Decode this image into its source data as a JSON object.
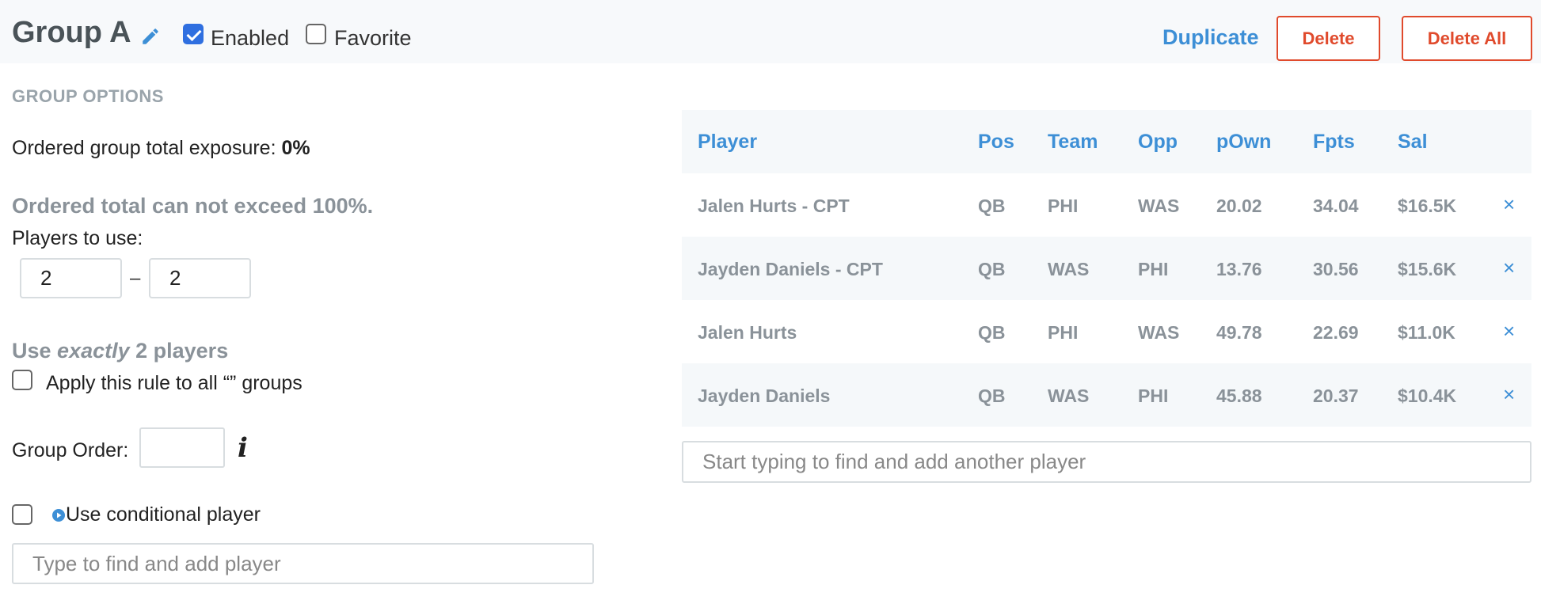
{
  "header": {
    "title": "Group A",
    "edit_icon": "pencil-icon",
    "enabled_label": "Enabled",
    "enabled_checked": true,
    "favorite_label": "Favorite",
    "favorite_checked": false,
    "duplicate_label": "Duplicate",
    "delete_label": "Delete",
    "delete_all_label": "Delete All"
  },
  "options": {
    "section_title": "GROUP OPTIONS",
    "exposure_prefix": "Ordered group total exposure: ",
    "exposure_value": "0%",
    "limit_note": "Ordered total can not exceed 100%.",
    "players_to_use_label": "Players to use:",
    "min_players": "2",
    "range_separator": "–",
    "max_players": "2",
    "summary_prefix": "Use ",
    "summary_emphasis": "exactly",
    "summary_suffix": " 2 players",
    "apply_all_label": "Apply this rule to all “” groups",
    "apply_all_checked": false,
    "group_order_label": "Group Order:",
    "group_order_value": "",
    "info_icon": "info-icon",
    "conditional_label": "Use conditional player",
    "conditional_checked": false,
    "conditional_icon": "play-circle-icon",
    "conditional_search_placeholder": "Type to find and add player"
  },
  "players_table": {
    "columns": [
      "Player",
      "Pos",
      "Team",
      "Opp",
      "pOwn",
      "Fpts",
      "Sal"
    ],
    "rows": [
      {
        "player": "Jalen Hurts - CPT",
        "pos": "QB",
        "team": "PHI",
        "opp": "WAS",
        "pown": "20.02",
        "fpts": "34.04",
        "sal": "$16.5K"
      },
      {
        "player": "Jayden Daniels - CPT",
        "pos": "QB",
        "team": "WAS",
        "opp": "PHI",
        "pown": "13.76",
        "fpts": "30.56",
        "sal": "$15.6K"
      },
      {
        "player": "Jalen Hurts",
        "pos": "QB",
        "team": "PHI",
        "opp": "WAS",
        "pown": "49.78",
        "fpts": "22.69",
        "sal": "$11.0K"
      },
      {
        "player": "Jayden Daniels",
        "pos": "QB",
        "team": "WAS",
        "opp": "PHI",
        "pown": "45.88",
        "fpts": "20.37",
        "sal": "$10.4K"
      }
    ],
    "remove_symbol": "×",
    "add_player_placeholder": "Start typing to find and add another player"
  },
  "colors": {
    "accent_blue": "#3d8fd6",
    "danger_red": "#e04a2c",
    "muted_gray": "#8a9299"
  }
}
